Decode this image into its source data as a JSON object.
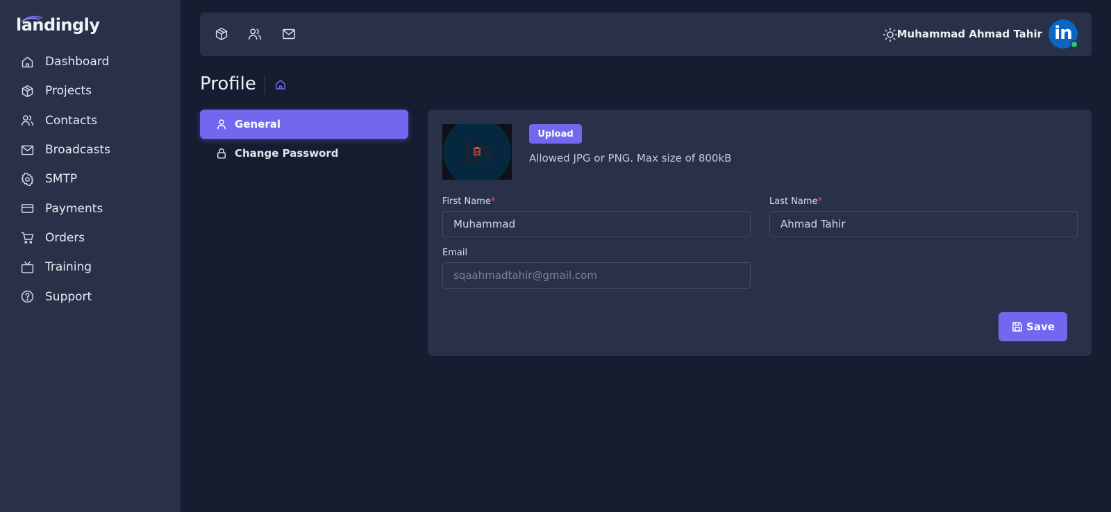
{
  "app": {
    "name": "landingly"
  },
  "sidebar": {
    "items": [
      {
        "label": "Dashboard",
        "icon": "home-icon"
      },
      {
        "label": "Projects",
        "icon": "cube-icon"
      },
      {
        "label": "Contacts",
        "icon": "users-icon"
      },
      {
        "label": "Broadcasts",
        "icon": "mail-icon"
      },
      {
        "label": "SMTP",
        "icon": "gear-icon"
      },
      {
        "label": "Payments",
        "icon": "credit-card-icon"
      },
      {
        "label": "Orders",
        "icon": "cart-icon"
      },
      {
        "label": "Training",
        "icon": "tv-icon"
      },
      {
        "label": "Support",
        "icon": "help-circle-icon"
      }
    ]
  },
  "topbar": {
    "shortcuts": [
      "cube-icon",
      "users-icon",
      "mail-icon"
    ],
    "theme_icon": "sun-icon",
    "user_name": "Muhammad Ahmad Tahir",
    "avatar_text": "in",
    "status": "online"
  },
  "page": {
    "title": "Profile",
    "breadcrumb_icon": "home-icon"
  },
  "tabs": {
    "general": "General",
    "password": "Change Password"
  },
  "profile": {
    "photo_text": "in",
    "upload_label": "Upload",
    "upload_hint": "Allowed JPG or PNG. Max size of 800kB",
    "first_name_label": "First Name",
    "first_name_value": "Muhammad",
    "last_name_label": "Last Name",
    "last_name_value": "Ahmad Tahir",
    "required_mark": "*",
    "email_label": "Email",
    "email_value": "sqaahmadtahir@gmail.com",
    "save_label": "Save"
  },
  "colors": {
    "accent": "#7367f0",
    "background": "#161d30",
    "panel": "#283148",
    "required": "#ea5455",
    "online": "#28c76f"
  }
}
